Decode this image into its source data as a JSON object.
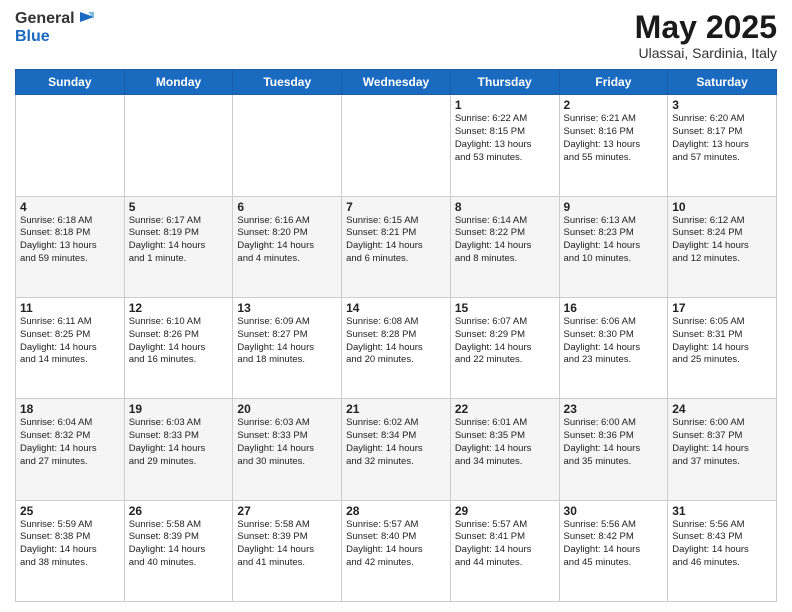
{
  "logo": {
    "general": "General",
    "blue": "Blue"
  },
  "header": {
    "month": "May 2025",
    "location": "Ulassai, Sardinia, Italy"
  },
  "days": [
    "Sunday",
    "Monday",
    "Tuesday",
    "Wednesday",
    "Thursday",
    "Friday",
    "Saturday"
  ],
  "weeks": [
    [
      {
        "date": "",
        "lines": []
      },
      {
        "date": "",
        "lines": []
      },
      {
        "date": "",
        "lines": []
      },
      {
        "date": "",
        "lines": []
      },
      {
        "date": "1",
        "lines": [
          "Sunrise: 6:22 AM",
          "Sunset: 8:15 PM",
          "Daylight: 13 hours",
          "and 53 minutes."
        ]
      },
      {
        "date": "2",
        "lines": [
          "Sunrise: 6:21 AM",
          "Sunset: 8:16 PM",
          "Daylight: 13 hours",
          "and 55 minutes."
        ]
      },
      {
        "date": "3",
        "lines": [
          "Sunrise: 6:20 AM",
          "Sunset: 8:17 PM",
          "Daylight: 13 hours",
          "and 57 minutes."
        ]
      }
    ],
    [
      {
        "date": "4",
        "lines": [
          "Sunrise: 6:18 AM",
          "Sunset: 8:18 PM",
          "Daylight: 13 hours",
          "and 59 minutes."
        ]
      },
      {
        "date": "5",
        "lines": [
          "Sunrise: 6:17 AM",
          "Sunset: 8:19 PM",
          "Daylight: 14 hours",
          "and 1 minute."
        ]
      },
      {
        "date": "6",
        "lines": [
          "Sunrise: 6:16 AM",
          "Sunset: 8:20 PM",
          "Daylight: 14 hours",
          "and 4 minutes."
        ]
      },
      {
        "date": "7",
        "lines": [
          "Sunrise: 6:15 AM",
          "Sunset: 8:21 PM",
          "Daylight: 14 hours",
          "and 6 minutes."
        ]
      },
      {
        "date": "8",
        "lines": [
          "Sunrise: 6:14 AM",
          "Sunset: 8:22 PM",
          "Daylight: 14 hours",
          "and 8 minutes."
        ]
      },
      {
        "date": "9",
        "lines": [
          "Sunrise: 6:13 AM",
          "Sunset: 8:23 PM",
          "Daylight: 14 hours",
          "and 10 minutes."
        ]
      },
      {
        "date": "10",
        "lines": [
          "Sunrise: 6:12 AM",
          "Sunset: 8:24 PM",
          "Daylight: 14 hours",
          "and 12 minutes."
        ]
      }
    ],
    [
      {
        "date": "11",
        "lines": [
          "Sunrise: 6:11 AM",
          "Sunset: 8:25 PM",
          "Daylight: 14 hours",
          "and 14 minutes."
        ]
      },
      {
        "date": "12",
        "lines": [
          "Sunrise: 6:10 AM",
          "Sunset: 8:26 PM",
          "Daylight: 14 hours",
          "and 16 minutes."
        ]
      },
      {
        "date": "13",
        "lines": [
          "Sunrise: 6:09 AM",
          "Sunset: 8:27 PM",
          "Daylight: 14 hours",
          "and 18 minutes."
        ]
      },
      {
        "date": "14",
        "lines": [
          "Sunrise: 6:08 AM",
          "Sunset: 8:28 PM",
          "Daylight: 14 hours",
          "and 20 minutes."
        ]
      },
      {
        "date": "15",
        "lines": [
          "Sunrise: 6:07 AM",
          "Sunset: 8:29 PM",
          "Daylight: 14 hours",
          "and 22 minutes."
        ]
      },
      {
        "date": "16",
        "lines": [
          "Sunrise: 6:06 AM",
          "Sunset: 8:30 PM",
          "Daylight: 14 hours",
          "and 23 minutes."
        ]
      },
      {
        "date": "17",
        "lines": [
          "Sunrise: 6:05 AM",
          "Sunset: 8:31 PM",
          "Daylight: 14 hours",
          "and 25 minutes."
        ]
      }
    ],
    [
      {
        "date": "18",
        "lines": [
          "Sunrise: 6:04 AM",
          "Sunset: 8:32 PM",
          "Daylight: 14 hours",
          "and 27 minutes."
        ]
      },
      {
        "date": "19",
        "lines": [
          "Sunrise: 6:03 AM",
          "Sunset: 8:33 PM",
          "Daylight: 14 hours",
          "and 29 minutes."
        ]
      },
      {
        "date": "20",
        "lines": [
          "Sunrise: 6:03 AM",
          "Sunset: 8:33 PM",
          "Daylight: 14 hours",
          "and 30 minutes."
        ]
      },
      {
        "date": "21",
        "lines": [
          "Sunrise: 6:02 AM",
          "Sunset: 8:34 PM",
          "Daylight: 14 hours",
          "and 32 minutes."
        ]
      },
      {
        "date": "22",
        "lines": [
          "Sunrise: 6:01 AM",
          "Sunset: 8:35 PM",
          "Daylight: 14 hours",
          "and 34 minutes."
        ]
      },
      {
        "date": "23",
        "lines": [
          "Sunrise: 6:00 AM",
          "Sunset: 8:36 PM",
          "Daylight: 14 hours",
          "and 35 minutes."
        ]
      },
      {
        "date": "24",
        "lines": [
          "Sunrise: 6:00 AM",
          "Sunset: 8:37 PM",
          "Daylight: 14 hours",
          "and 37 minutes."
        ]
      }
    ],
    [
      {
        "date": "25",
        "lines": [
          "Sunrise: 5:59 AM",
          "Sunset: 8:38 PM",
          "Daylight: 14 hours",
          "and 38 minutes."
        ]
      },
      {
        "date": "26",
        "lines": [
          "Sunrise: 5:58 AM",
          "Sunset: 8:39 PM",
          "Daylight: 14 hours",
          "and 40 minutes."
        ]
      },
      {
        "date": "27",
        "lines": [
          "Sunrise: 5:58 AM",
          "Sunset: 8:39 PM",
          "Daylight: 14 hours",
          "and 41 minutes."
        ]
      },
      {
        "date": "28",
        "lines": [
          "Sunrise: 5:57 AM",
          "Sunset: 8:40 PM",
          "Daylight: 14 hours",
          "and 42 minutes."
        ]
      },
      {
        "date": "29",
        "lines": [
          "Sunrise: 5:57 AM",
          "Sunset: 8:41 PM",
          "Daylight: 14 hours",
          "and 44 minutes."
        ]
      },
      {
        "date": "30",
        "lines": [
          "Sunrise: 5:56 AM",
          "Sunset: 8:42 PM",
          "Daylight: 14 hours",
          "and 45 minutes."
        ]
      },
      {
        "date": "31",
        "lines": [
          "Sunrise: 5:56 AM",
          "Sunset: 8:43 PM",
          "Daylight: 14 hours",
          "and 46 minutes."
        ]
      }
    ]
  ]
}
